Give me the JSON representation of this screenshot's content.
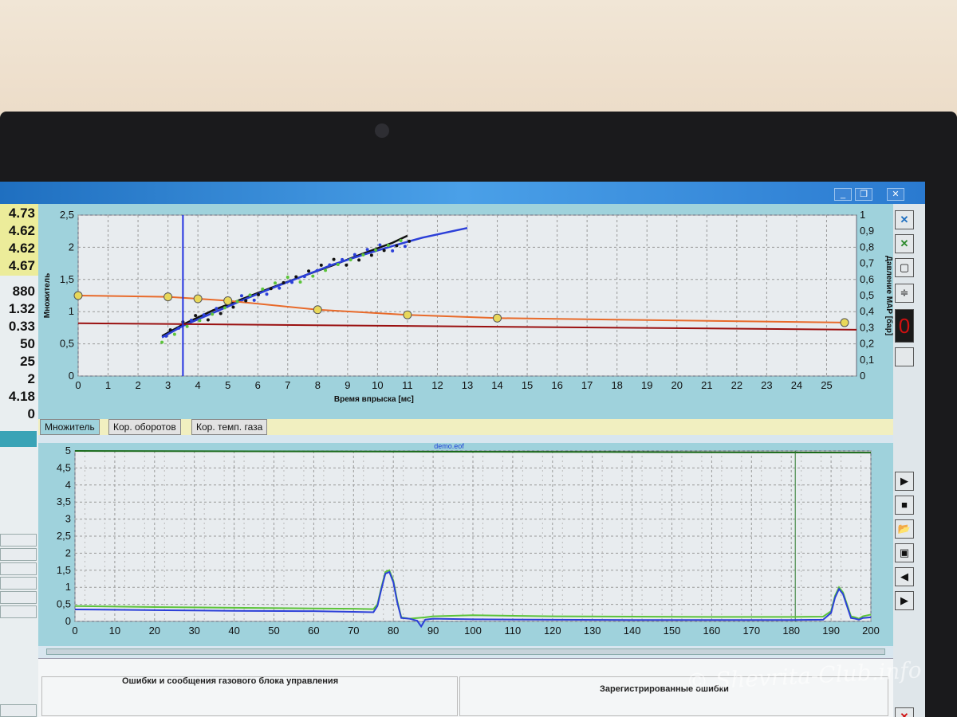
{
  "left_values": [
    "4.73",
    "4.62",
    "4.62",
    "4.67",
    "880",
    "1.32",
    "0.33",
    "50",
    "25",
    "2",
    "4.18",
    "0"
  ],
  "tabs": [
    "Множитель",
    "Кор. оборотов",
    "Кор. темп. газа"
  ],
  "bottom": {
    "errors_title": "Ошибки и сообщения газового блока управления",
    "registered_title": "Зарегистрированные ошибки"
  },
  "watermark": "© Shevrita-Club.info",
  "colors": {
    "plot_bg": "#e8ecef",
    "frame": "#9fd2dc",
    "blue_series": "#2b3fd8",
    "green_series": "#5cc43a",
    "black_series": "#111111",
    "orange_line": "#e86a2a",
    "darkred_line": "#9a1010",
    "marker_fill": "#e8d85a"
  },
  "chart_data": [
    {
      "type": "line",
      "xlabel": "Время впрыска [мс]",
      "ylabel": "Множитель",
      "y2label": "Давление MAP [бар]",
      "xlim": [
        0,
        26
      ],
      "ylim": [
        0,
        2.5
      ],
      "y2lim": [
        0,
        1
      ],
      "x_ticks": [
        0,
        1,
        2,
        3,
        4,
        5,
        6,
        7,
        8,
        9,
        10,
        11,
        12,
        13,
        14,
        15,
        16,
        17,
        18,
        19,
        20,
        21,
        22,
        23,
        24,
        25
      ],
      "y_ticks": [
        "0",
        "0,5",
        "1",
        "1,5",
        "2",
        "2,5"
      ],
      "y2_ticks": [
        "0",
        "0,1",
        "0,2",
        "0,3",
        "0,4",
        "0,5",
        "0,6",
        "0,7",
        "0,8",
        "0,9",
        "1"
      ],
      "cursor_x": 3.5,
      "series": [
        {
          "values_x": [
            2.8,
            3.5,
            4.5,
            5.5,
            6.5,
            7.5,
            8.5,
            9.5,
            10.5,
            11
          ],
          "values_y": [
            0.62,
            0.8,
            1.02,
            1.2,
            1.38,
            1.55,
            1.72,
            1.9,
            2.07,
            2.18
          ]
        },
        {
          "values_x": [
            2.8,
            3.5,
            4.5,
            5.5,
            6.5,
            7.5,
            8.5,
            9.5,
            10.5,
            11.5,
            12.5,
            13
          ],
          "values_y": [
            0.6,
            0.78,
            0.98,
            1.18,
            1.37,
            1.55,
            1.73,
            1.88,
            2.02,
            2.15,
            2.25,
            2.3
          ]
        },
        {
          "values_x": [
            0,
            3,
            4,
            5,
            8,
            11,
            14,
            25.6
          ],
          "values_y": [
            1.25,
            1.23,
            1.2,
            1.17,
            1.03,
            0.95,
            0.9,
            0.83
          ]
        },
        {
          "values_x": [
            0,
            26
          ],
          "values_y": [
            0.82,
            0.72
          ]
        }
      ],
      "markers_x": [
        0,
        3,
        4,
        5,
        8,
        11,
        14,
        25.6
      ],
      "markers_y": [
        1.25,
        1.23,
        1.2,
        1.17,
        1.03,
        0.95,
        0.9,
        0.83
      ]
    },
    {
      "type": "line",
      "title": "demo.eof",
      "xlim": [
        0,
        200
      ],
      "ylim": [
        0,
        5
      ],
      "x_ticks": [
        0,
        10,
        20,
        30,
        40,
        50,
        60,
        70,
        80,
        90,
        100,
        110,
        120,
        130,
        140,
        150,
        160,
        170,
        180,
        190,
        200
      ],
      "y_ticks": [
        "0",
        "0,5",
        "1",
        "1,5",
        "2",
        "2,5",
        "3",
        "3,5",
        "4",
        "4,5",
        "5"
      ],
      "cursor_x": 181,
      "series": [
        {
          "x": [
            0,
            20,
            40,
            60,
            70,
            75,
            76,
            77,
            78,
            79,
            80,
            81,
            82,
            84,
            86,
            88,
            90,
            100,
            120,
            140,
            160,
            180,
            188,
            190,
            191,
            192,
            193,
            194,
            195,
            196,
            197,
            198,
            200
          ],
          "y": [
            0.45,
            0.42,
            0.4,
            0.38,
            0.37,
            0.36,
            0.5,
            1.0,
            1.45,
            1.5,
            1.2,
            0.6,
            0.12,
            0.08,
            0.1,
            0.12,
            0.15,
            0.18,
            0.15,
            0.14,
            0.13,
            0.13,
            0.14,
            0.3,
            0.75,
            1.0,
            0.85,
            0.5,
            0.15,
            0.12,
            0.08,
            0.15,
            0.2
          ]
        },
        {
          "x": [
            0,
            20,
            40,
            60,
            70,
            75,
            76,
            77,
            78,
            79,
            80,
            81,
            82,
            84,
            86,
            87,
            88,
            90,
            100,
            120,
            140,
            160,
            180,
            188,
            190,
            191,
            192,
            193,
            194,
            195,
            196,
            197,
            198,
            200
          ],
          "y": [
            0.35,
            0.33,
            0.31,
            0.3,
            0.28,
            0.27,
            0.45,
            0.95,
            1.4,
            1.45,
            1.15,
            0.55,
            0.1,
            0.08,
            0.02,
            -0.15,
            0.05,
            0.08,
            0.06,
            0.05,
            0.04,
            0.04,
            0.04,
            0.05,
            0.25,
            0.7,
            0.95,
            0.8,
            0.45,
            0.1,
            0.08,
            0.05,
            0.1,
            0.12
          ]
        }
      ]
    }
  ]
}
